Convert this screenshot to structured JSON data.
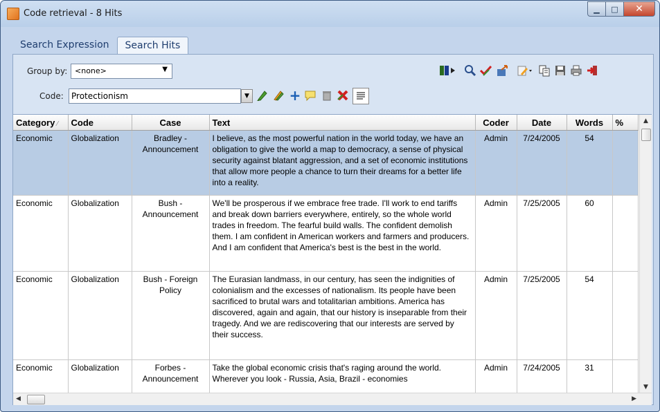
{
  "window": {
    "title": "Code retrieval - 8 Hits"
  },
  "tabs": [
    {
      "label": "Search Expression"
    },
    {
      "label": "Search Hits"
    }
  ],
  "toolbar": {
    "group_by_label": "Group by:",
    "group_by_value": "<none>",
    "code_label": "Code:",
    "code_value": "Protectionism"
  },
  "columns": [
    "Category",
    "Code",
    "Case",
    "Text",
    "Coder",
    "Date",
    "Words",
    "%"
  ],
  "rows": [
    {
      "category": "Economic",
      "code": "Globalization",
      "case": "Bradley - Announcement",
      "text": "I believe, as the most powerful nation in the world today, we have an obligation to give the world a map to democracy, a sense of physical security against blatant aggression, and a set of economic institutions that allow more people a chance to turn their dreams for a better life into a reality.",
      "coder": "Admin",
      "date": "7/24/2005",
      "words": "54",
      "selected": true
    },
    {
      "category": "Economic",
      "code": "Globalization",
      "case": "Bush - Announcement",
      "text": "We'll be prosperous if we embrace free trade. I'll work to end tariffs and break down barriers everywhere, entirely, so the whole world trades in freedom. The fearful build walls. The confident demolish them. I am confident in American workers and farmers and producers. And I am confident that America's best is the best in the world.",
      "coder": "Admin",
      "date": "7/25/2005",
      "words": "60",
      "selected": false
    },
    {
      "category": "Economic",
      "code": "Globalization",
      "case": "Bush - Foreign Policy",
      "text": "The Eurasian landmass, in our century, has seen the indignities of colonialism and the excesses of nationalism. Its people have been sacrificed to brutal wars and totalitarian ambitions. America has discovered, again and again, that our history is inseparable from their tragedy. And we are rediscovering that our interests are served by their success.",
      "coder": "Admin",
      "date": "7/25/2005",
      "words": "54",
      "selected": false
    },
    {
      "category": "Economic",
      "code": "Globalization",
      "case": "Forbes - Announcement",
      "text": "Take the global economic crisis that's raging around the world. Wherever you look - Russia, Asia, Brazil - economies",
      "coder": "Admin",
      "date": "7/24/2005",
      "words": "31",
      "selected": false
    }
  ],
  "colors": {
    "selected_row": "#b8cce4",
    "title_bar": "#c4d5ec"
  }
}
